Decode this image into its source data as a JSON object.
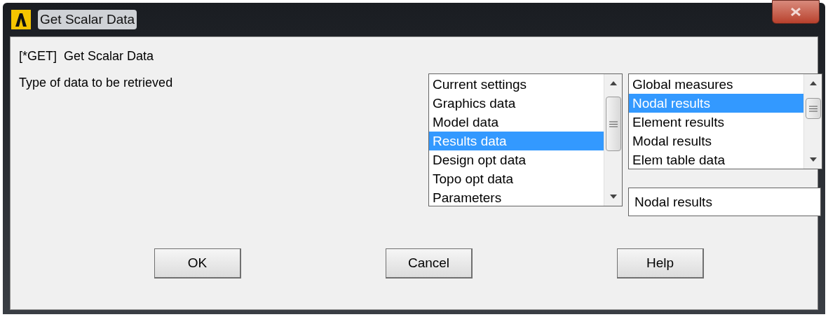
{
  "window": {
    "title": "Get Scalar Data"
  },
  "command": "[*GET]  Get Scalar Data",
  "prompt": "Type of data to be retrieved",
  "list_1": [
    {
      "label": "Current settings",
      "selected": false
    },
    {
      "label": "Graphics data",
      "selected": false
    },
    {
      "label": "Model data",
      "selected": false
    },
    {
      "label": "Results data",
      "selected": true
    },
    {
      "label": "Design opt data",
      "selected": false
    },
    {
      "label": "Topo opt data",
      "selected": false
    },
    {
      "label": "Parameters",
      "selected": false
    }
  ],
  "list_2": [
    {
      "label": "Global measures",
      "selected": false
    },
    {
      "label": "Nodal results",
      "selected": true
    },
    {
      "label": "Element results",
      "selected": false
    },
    {
      "label": "Modal results",
      "selected": false
    },
    {
      "label": "Elem table data",
      "selected": false
    }
  ],
  "selection_field": {
    "value": "Nodal results"
  },
  "buttons": [
    "OK",
    "Cancel",
    "Help"
  ]
}
